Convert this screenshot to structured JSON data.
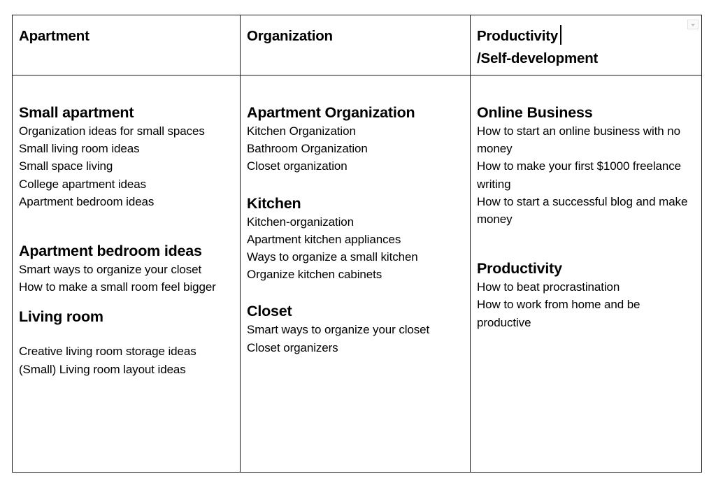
{
  "table": {
    "headers": [
      {
        "text": "Apartment"
      },
      {
        "text": "Organization"
      },
      {
        "text": "Productivity",
        "text_line2": "/Self-development"
      }
    ],
    "columns": [
      {
        "sections": [
          {
            "title": "Small apartment",
            "items": [
              "Organization ideas for small spaces",
              "Small living room ideas",
              "Small space living",
              "College apartment ideas",
              "Apartment bedroom ideas"
            ]
          },
          {
            "title": "Apartment bedroom ideas",
            "items": [
              "Smart ways to organize your closet",
              "How to make a small room feel bigger"
            ]
          },
          {
            "title": "Living room",
            "items": [
              "Creative living room storage ideas",
              "(Small) Living room layout ideas"
            ]
          }
        ]
      },
      {
        "sections": [
          {
            "title": "Apartment Organization",
            "items": [
              "Kitchen Organization",
              "Bathroom Organization",
              "Closet organization"
            ]
          },
          {
            "title": "Kitchen",
            "items": [
              "Kitchen-organization",
              "Apartment kitchen appliances",
              "Ways to organize a small kitchen",
              "Organize kitchen cabinets"
            ]
          },
          {
            "title": "Closet",
            "items": [
              "Smart ways to organize your closet",
              "Closet organizers"
            ]
          }
        ]
      },
      {
        "sections": [
          {
            "title": "Online Business",
            "items": [
              "How to start an online business with no money",
              "How to make your first $1000 freelance writing",
              "How to start a successful blog and make money"
            ]
          },
          {
            "title": "Productivity",
            "items": [
              "How to beat procrastination",
              "How to work from home and be productive"
            ]
          }
        ]
      }
    ]
  },
  "icons": {
    "cell_menu": "dropdown-arrow-icon",
    "text_cursor": "text-caret"
  }
}
